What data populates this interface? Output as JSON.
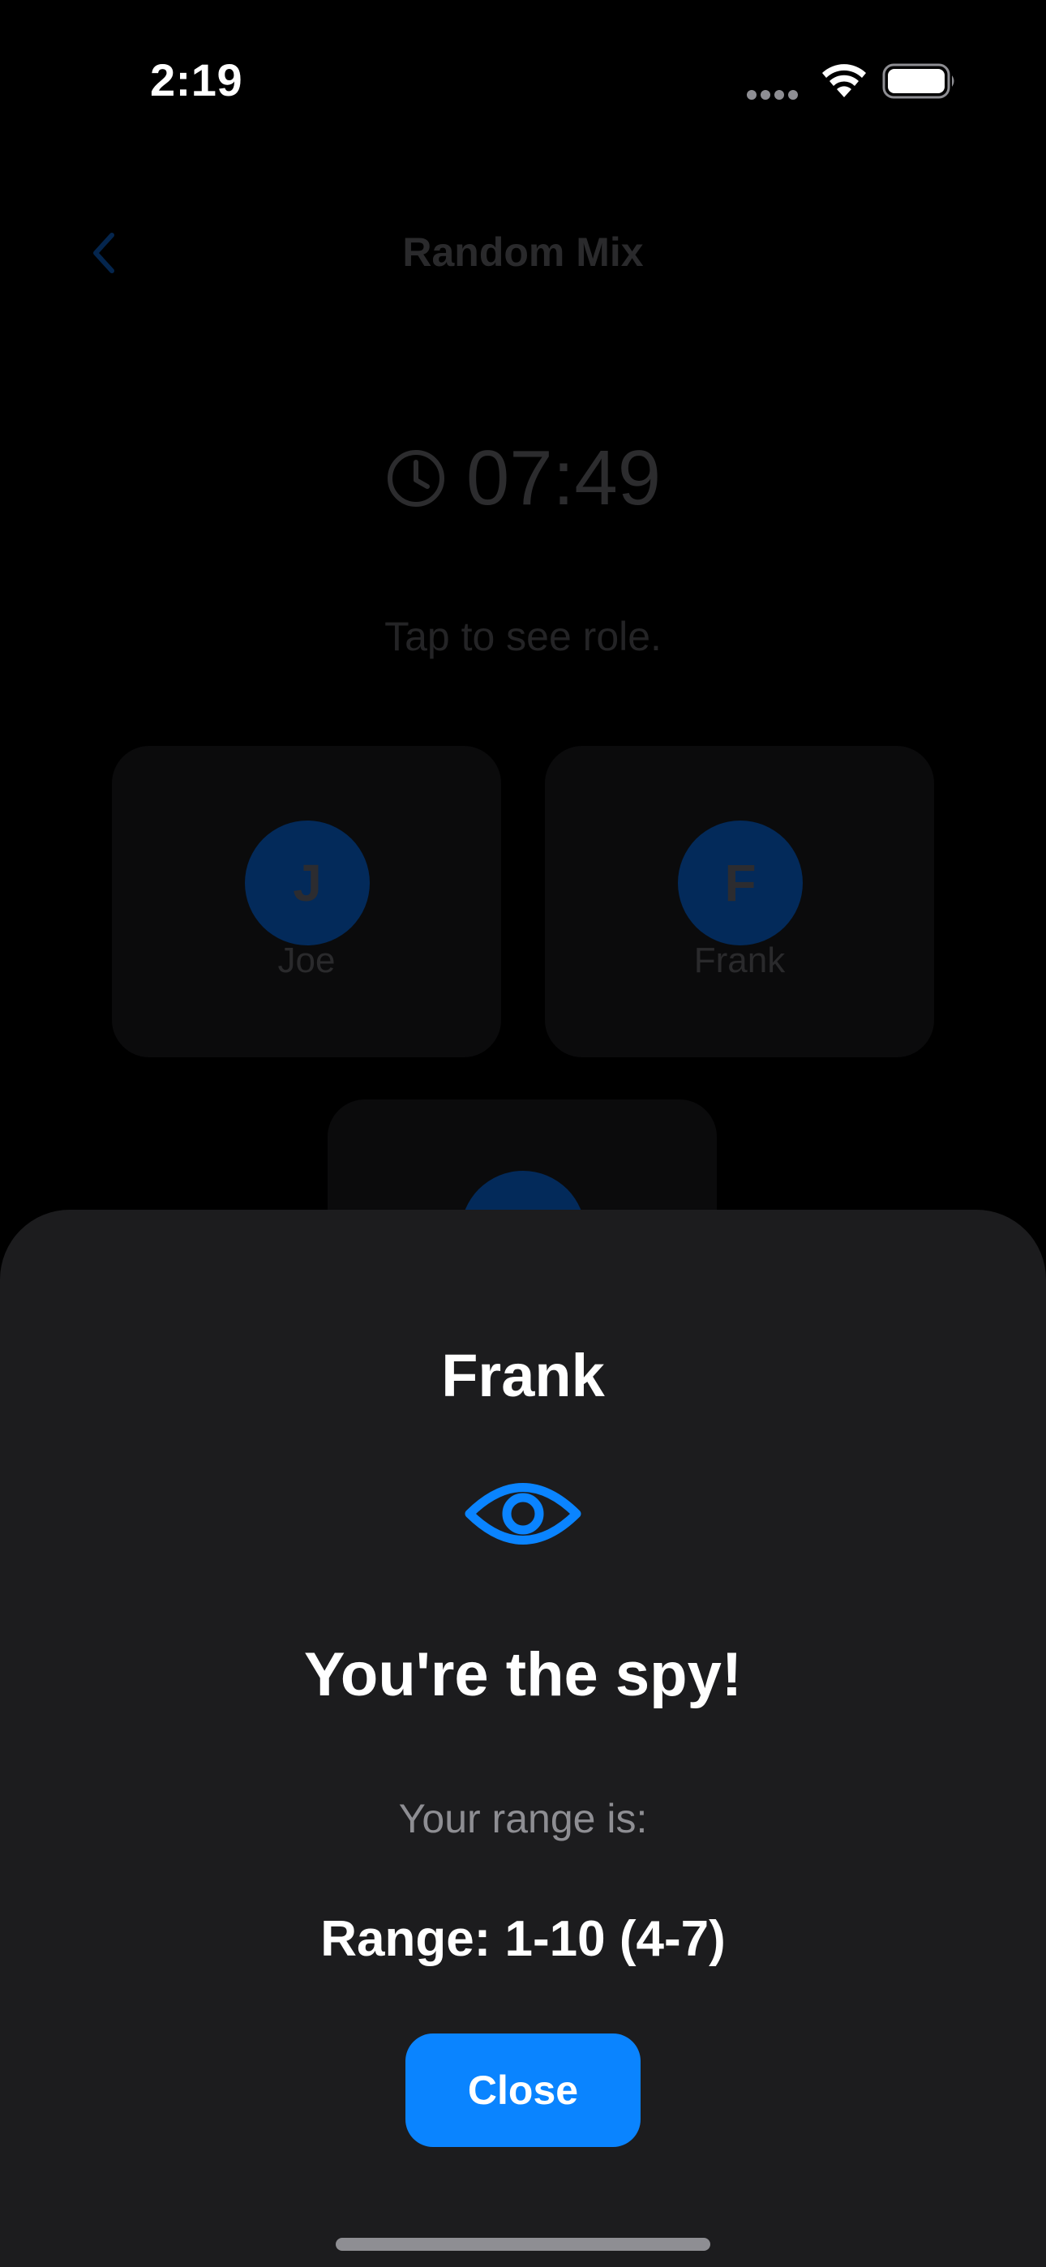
{
  "status_bar": {
    "time": "2:19",
    "icons": [
      "signal-dots-icon",
      "wifi-icon",
      "battery-icon"
    ]
  },
  "background_screen": {
    "nav": {
      "back_icon": "chevron-left-icon",
      "title": "Random Mix"
    },
    "timer": {
      "icon": "clock-icon",
      "value": "07:49"
    },
    "hint": "Tap to see role.",
    "players": [
      {
        "initial": "J",
        "name": "Joe"
      },
      {
        "initial": "F",
        "name": "Frank"
      }
    ]
  },
  "sheet": {
    "player_name": "Frank",
    "role_icon": "eye-icon",
    "role_text": "You're the spy!",
    "range_caption": "Your range is:",
    "range_value": "Range: 1-10 (4-7)",
    "close_label": "Close"
  },
  "colors": {
    "accent": "#0a84ff",
    "sheet_background": "#1c1c1e",
    "secondary_text": "#8e8e93"
  }
}
